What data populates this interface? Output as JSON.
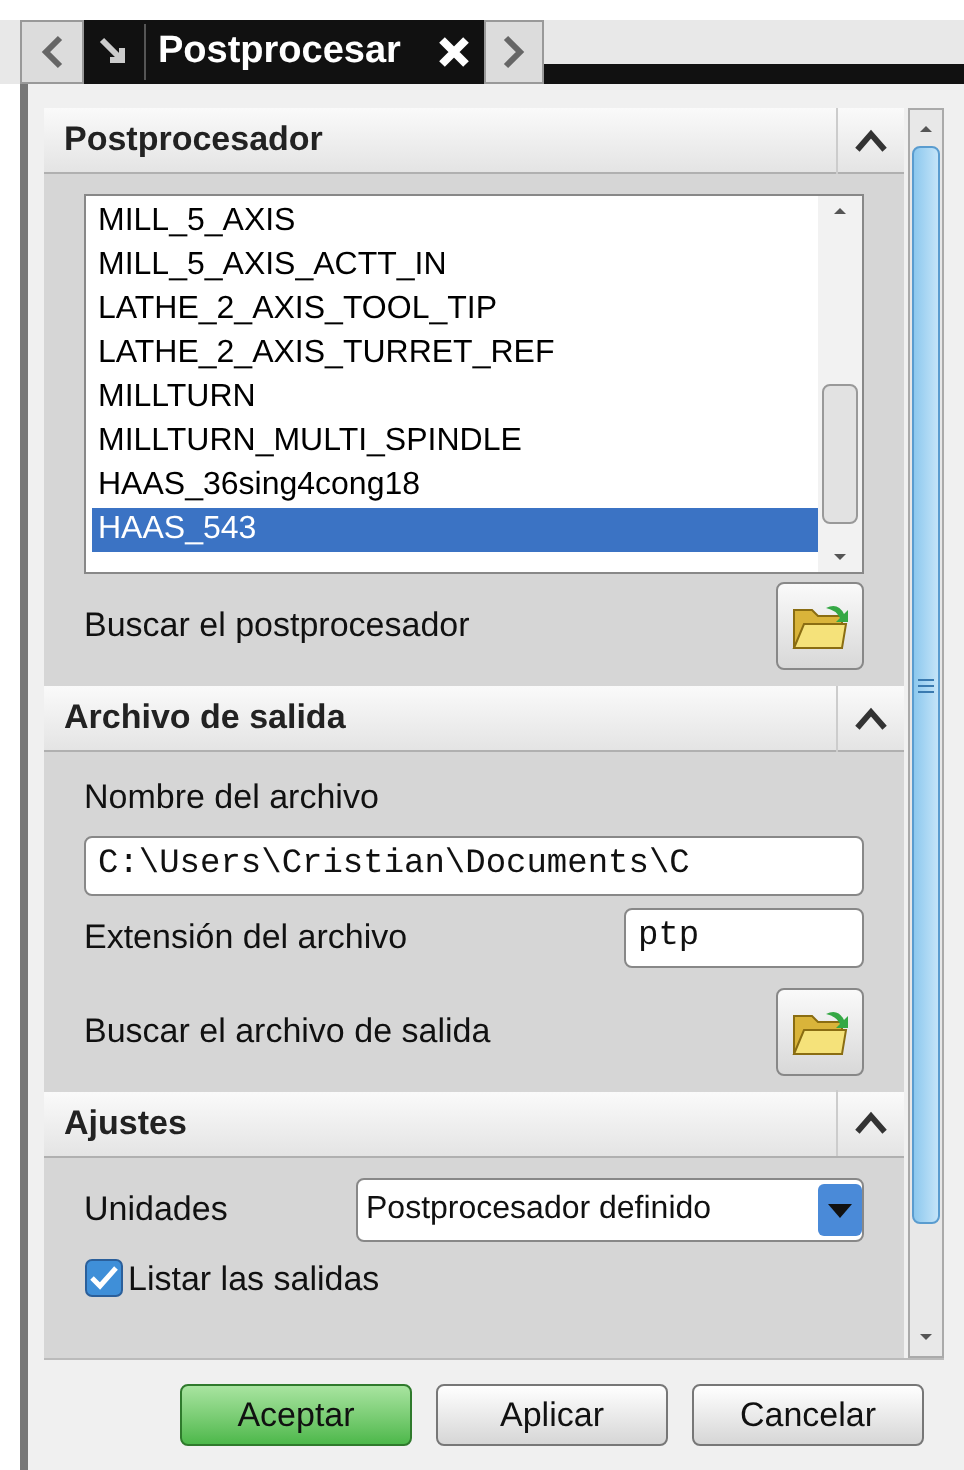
{
  "tab_bar": {
    "title": "Postprocesar"
  },
  "sections": [
    {
      "kind": "postprocessor",
      "title": "Postprocesador",
      "expanded": true,
      "items": [
        {
          "label": "MILL_5_AXIS",
          "selected": false
        },
        {
          "label": "MILL_5_AXIS_ACTT_IN",
          "selected": false
        },
        {
          "label": "LATHE_2_AXIS_TOOL_TIP",
          "selected": false
        },
        {
          "label": "LATHE_2_AXIS_TURRET_REF",
          "selected": false
        },
        {
          "label": "MILLTURN",
          "selected": false
        },
        {
          "label": "MILLTURN_MULTI_SPINDLE",
          "selected": false
        },
        {
          "label": "HAAS_36sing4cong18",
          "selected": false
        },
        {
          "label": "HAAS_543",
          "selected": true
        }
      ],
      "browse_label": "Buscar el postprocesador"
    },
    {
      "kind": "output",
      "title": "Archivo de salida",
      "expanded": true,
      "file_name_label": "Nombre del archivo",
      "file_name": "C:\\Users\\Cristian\\Documents\\C",
      "extension_label": "Extensión del archivo",
      "extension": "ptp",
      "browse_label": "Buscar el archivo de salida"
    },
    {
      "kind": "settings",
      "title": "Ajustes",
      "expanded": true,
      "units_label": "Unidades",
      "units": "Postprocesador definido",
      "list_output": {
        "label": "Listar las salidas",
        "checked": true
      }
    }
  ],
  "buttons": [
    {
      "label": "Aceptar",
      "kind": "primary"
    },
    {
      "label": "Aplicar",
      "kind": "normal"
    },
    {
      "label": "Cancelar",
      "kind": "normal"
    }
  ]
}
